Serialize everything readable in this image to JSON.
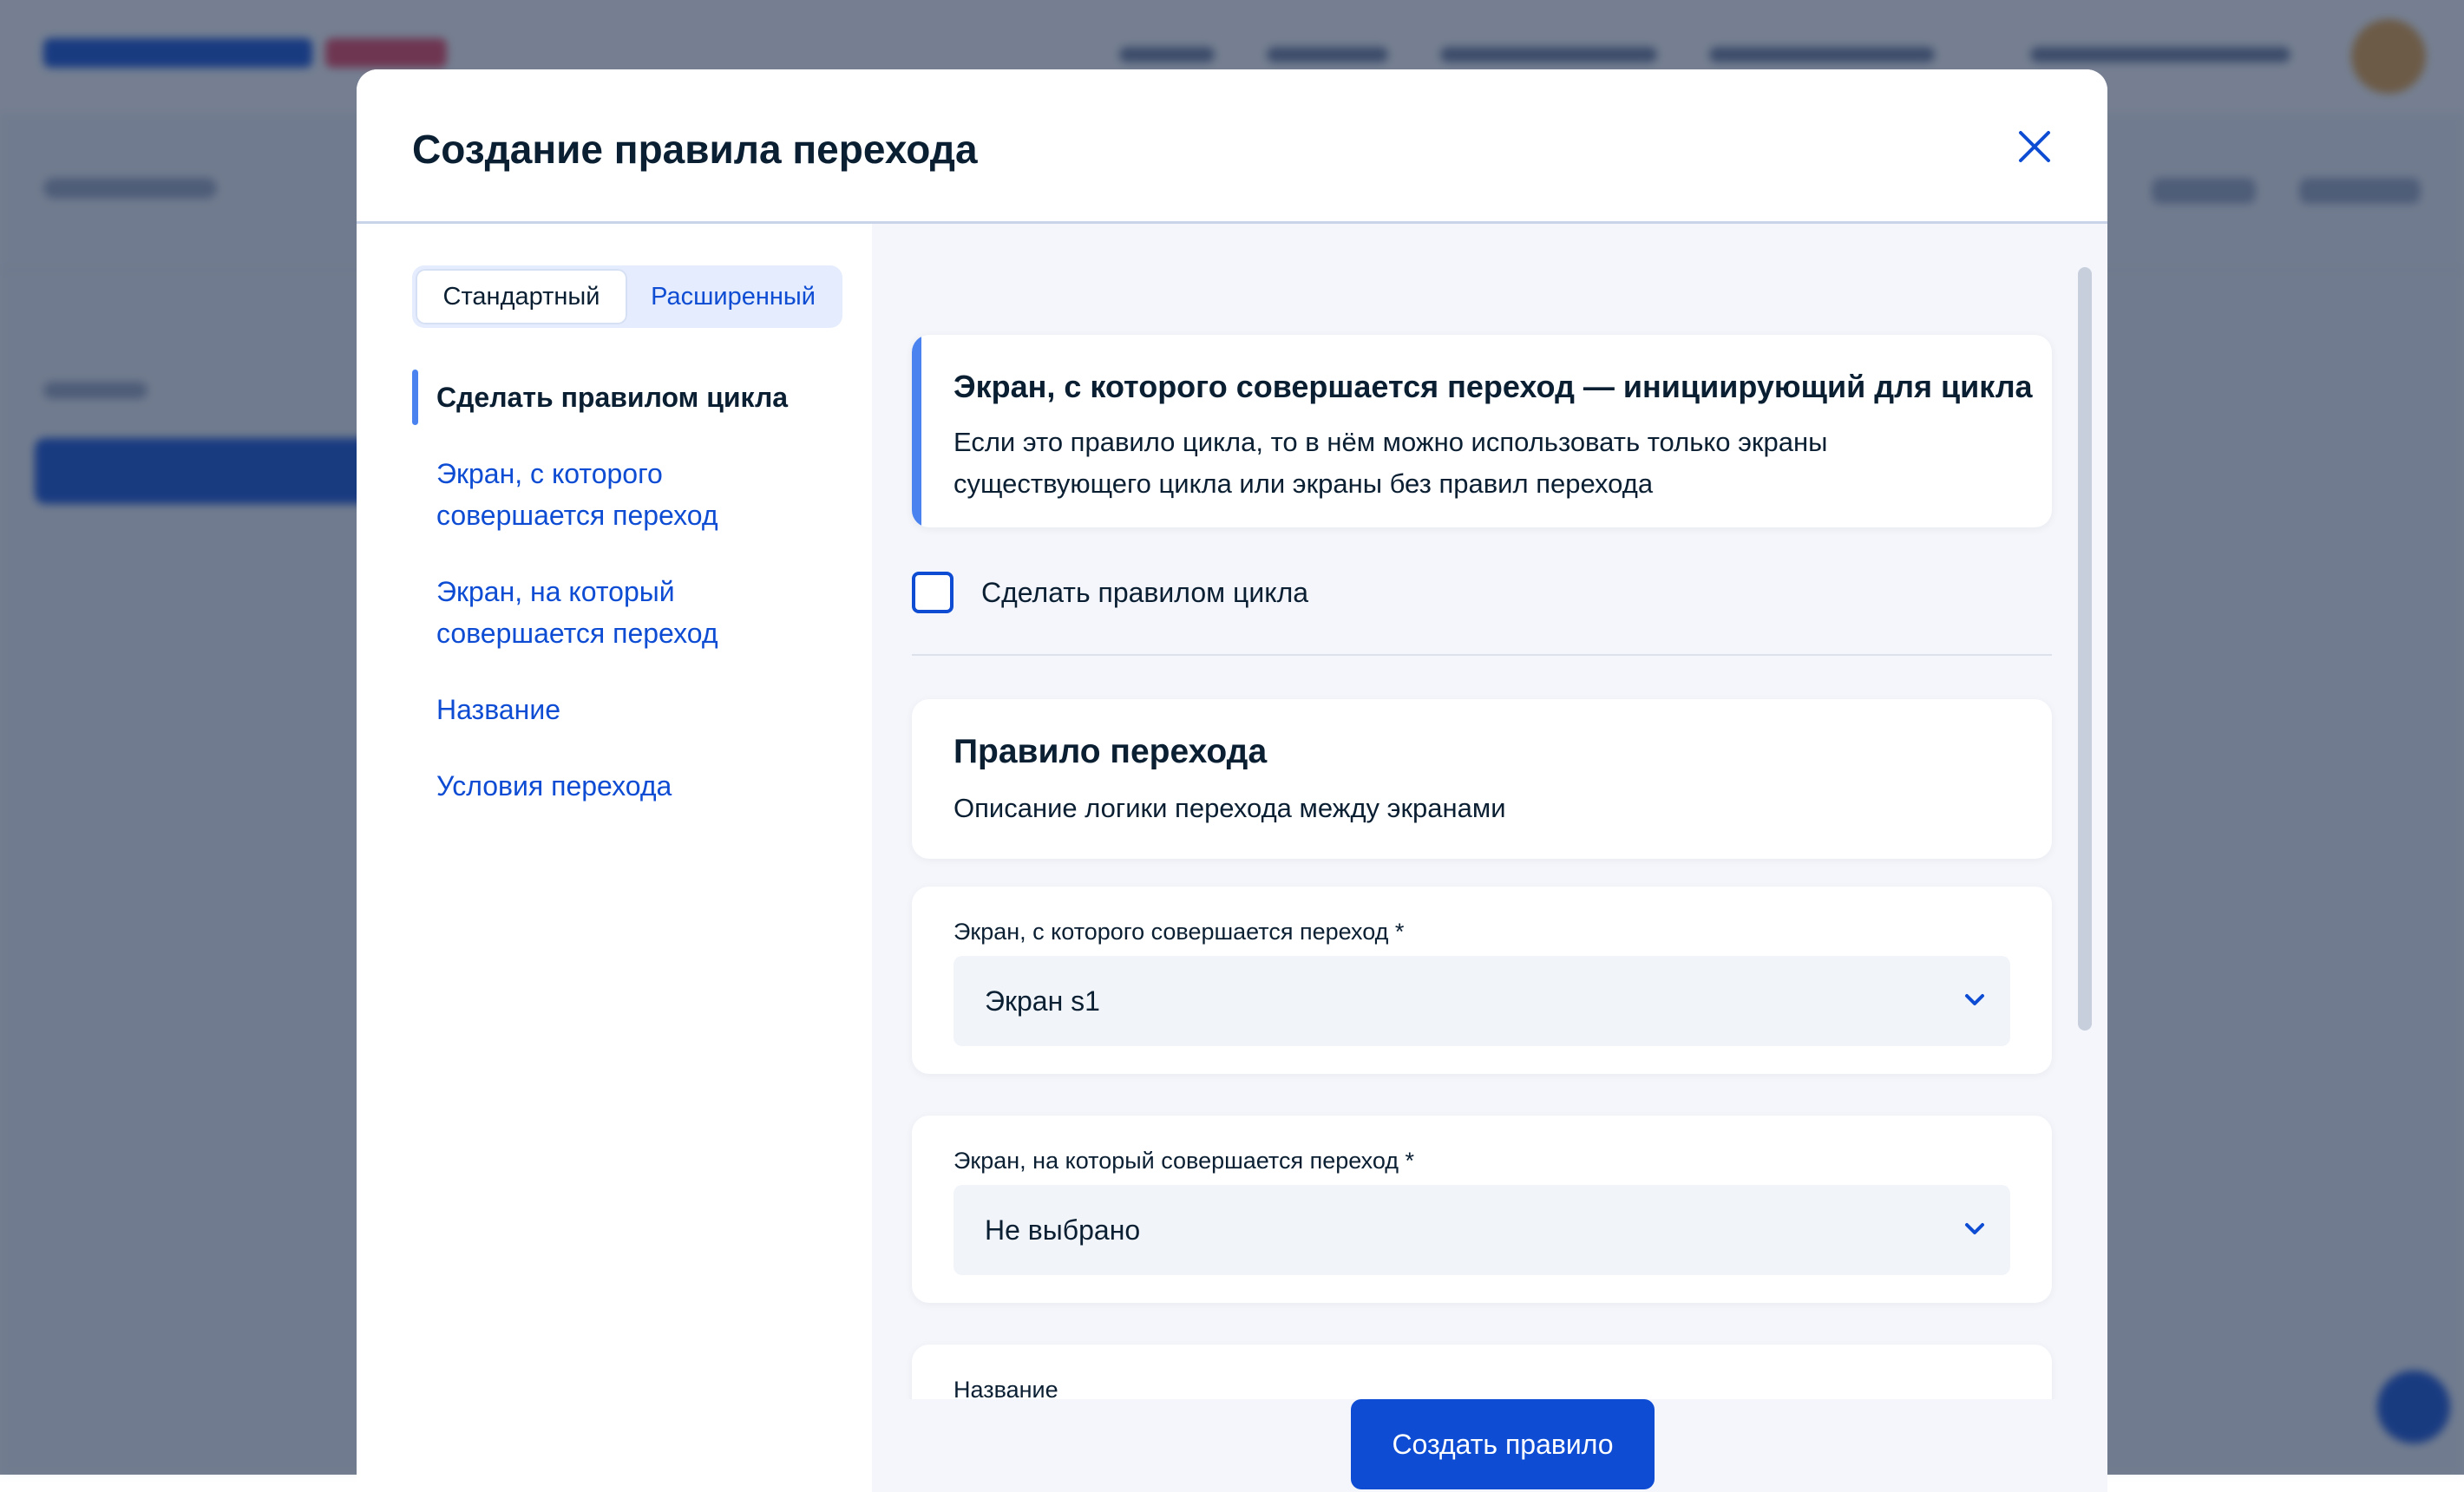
{
  "modal": {
    "title": "Создание правила перехода"
  },
  "mode_toggle": {
    "standard": "Стандартный",
    "advanced": "Расширенный",
    "selected": "standard"
  },
  "nav": {
    "items": [
      {
        "label": "Сделать правилом цикла",
        "active": true
      },
      {
        "label": "Экран, с которого совершается переход",
        "active": false
      },
      {
        "label": "Экран, на который совершается переход",
        "active": false
      },
      {
        "label": "Название",
        "active": false
      },
      {
        "label": "Условия перехода",
        "active": false
      }
    ]
  },
  "info": {
    "title": "Экран, с которого совершается переход — инициирующий для цикла",
    "text": "Если это правило цикла, то в нём можно использовать только экраны существующего цикла или экраны без правил перехода"
  },
  "loop_checkbox": {
    "label": "Сделать правилом цикла",
    "checked": false
  },
  "rule_section": {
    "title": "Правило перехода",
    "subtitle": "Описание логики перехода между экранами"
  },
  "fields": {
    "from_screen": {
      "label": "Экран, с которого совершается переход *",
      "value": "Экран s1"
    },
    "to_screen": {
      "label": "Экран, на который совершается переход *",
      "value": "Не выбрано"
    },
    "name": {
      "label": "Название"
    }
  },
  "footer": {
    "submit_label": "Создать правило"
  },
  "colors": {
    "accent": "#0d4cd3",
    "accent_light": "#4a83f0",
    "text": "#0b1f33",
    "overlay": "#20314e"
  }
}
